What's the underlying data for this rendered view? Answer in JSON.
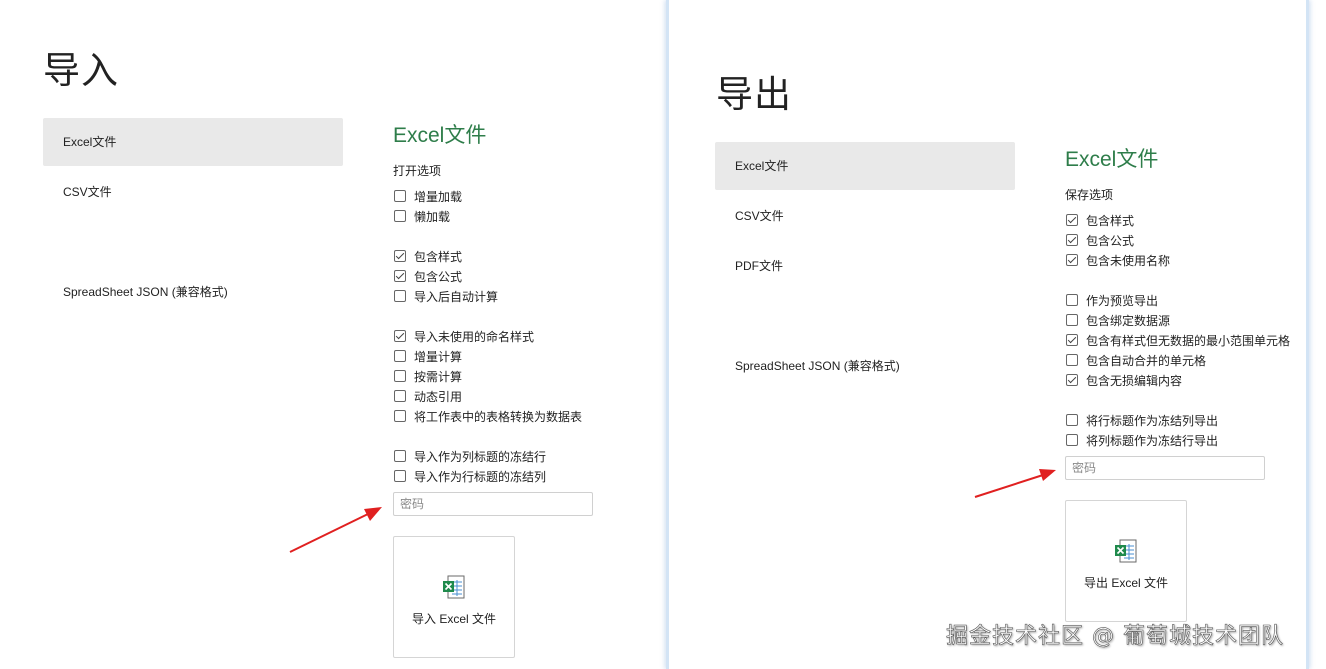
{
  "import": {
    "title": "导入",
    "nav": [
      "Excel文件",
      "CSV文件",
      "SpreadSheet JSON (兼容格式)"
    ],
    "section_title": "Excel文件",
    "options_label": "打开选项",
    "groups": [
      [
        {
          "label": "增量加载",
          "checked": false
        },
        {
          "label": "懒加载",
          "checked": false
        }
      ],
      [
        {
          "label": "包含样式",
          "checked": true
        },
        {
          "label": "包含公式",
          "checked": true
        },
        {
          "label": "导入后自动计算",
          "checked": false
        }
      ],
      [
        {
          "label": "导入未使用的命名样式",
          "checked": true
        },
        {
          "label": "增量计算",
          "checked": false
        },
        {
          "label": "按需计算",
          "checked": false
        },
        {
          "label": "动态引用",
          "checked": false
        },
        {
          "label": "将工作表中的表格转换为数据表",
          "checked": false
        }
      ],
      [
        {
          "label": "导入作为列标题的冻结行",
          "checked": false
        },
        {
          "label": "导入作为行标题的冻结列",
          "checked": false
        }
      ]
    ],
    "password_placeholder": "密码",
    "button_label": "导入 Excel 文件",
    "button_icon": "excel-file-icon"
  },
  "export": {
    "title": "导出",
    "nav": [
      "Excel文件",
      "CSV文件",
      "PDF文件",
      "SpreadSheet JSON (兼容格式)"
    ],
    "section_title": "Excel文件",
    "options_label": "保存选项",
    "groups": [
      [
        {
          "label": "包含样式",
          "checked": true
        },
        {
          "label": "包含公式",
          "checked": true
        },
        {
          "label": "包含未使用名称",
          "checked": true
        }
      ],
      [
        {
          "label": "作为预览导出",
          "checked": false
        },
        {
          "label": "包含绑定数据源",
          "checked": false
        },
        {
          "label": "包含有样式但无数据的最小范围单元格",
          "checked": true
        },
        {
          "label": "包含自动合并的单元格",
          "checked": false
        },
        {
          "label": "包含无损编辑内容",
          "checked": true
        }
      ],
      [
        {
          "label": "将行标题作为冻结列导出",
          "checked": false
        },
        {
          "label": "将列标题作为冻结行导出",
          "checked": false
        }
      ]
    ],
    "password_placeholder": "密码",
    "button_label": "导出 Excel 文件",
    "button_icon": "excel-file-icon"
  },
  "watermark": "掘金技术社区 @ 葡萄城技术团队",
  "colors": {
    "accent": "#2e7d4a",
    "arrow": "#e02020",
    "nav_active": "#e9e9e9"
  }
}
